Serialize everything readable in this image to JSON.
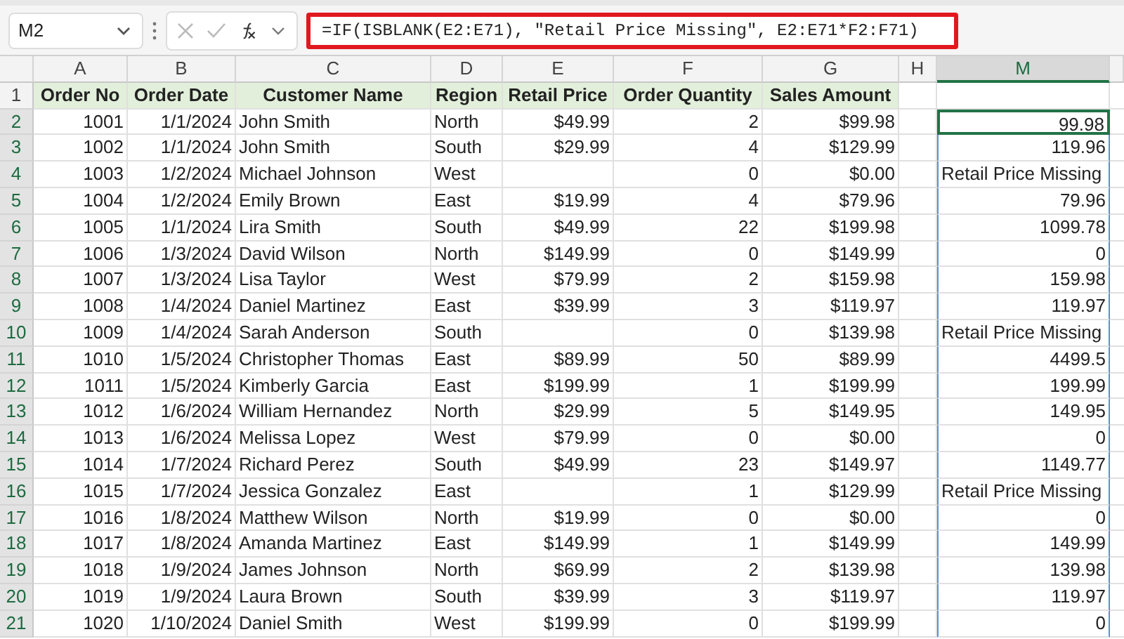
{
  "name_box": {
    "value": "M2"
  },
  "formula_bar": {
    "formula": "=IF(ISBLANK(E2:E71), \"Retail Price Missing\", E2:E71*F2:F71)",
    "highlighted": true
  },
  "column_headers": [
    {
      "label": "A",
      "selected": false
    },
    {
      "label": "B",
      "selected": false
    },
    {
      "label": "C",
      "selected": false
    },
    {
      "label": "D",
      "selected": false
    },
    {
      "label": "E",
      "selected": false
    },
    {
      "label": "F",
      "selected": false
    },
    {
      "label": "G",
      "selected": false
    },
    {
      "label": "H",
      "selected": false
    },
    {
      "label": "M",
      "selected": true
    }
  ],
  "rows": [
    {
      "number": "1",
      "kind": "header",
      "selected": false,
      "cells": [
        "Order No",
        "Order Date",
        "Customer Name",
        "Region",
        "Retail Price",
        "Order Quantity",
        "Sales Amount"
      ]
    },
    {
      "number": "2",
      "kind": "data",
      "selected": true,
      "cells": [
        "1001",
        "1/1/2024",
        "John Smith",
        "North",
        "$49.99",
        "2",
        "$99.98"
      ],
      "m": {
        "text": "99.98",
        "selected": true,
        "active": true
      }
    },
    {
      "number": "3",
      "kind": "data",
      "selected": true,
      "cells": [
        "1002",
        "1/1/2024",
        "John Smith",
        "South",
        "$29.99",
        "4",
        "$129.99"
      ],
      "m": {
        "text": "119.96",
        "selected": true,
        "active": false
      }
    },
    {
      "number": "4",
      "kind": "data",
      "selected": true,
      "cells": [
        "1003",
        "1/2/2024",
        "Michael Johnson",
        "West",
        null,
        "0",
        "$0.00"
      ],
      "m": {
        "text": "Retail Price Missing",
        "selected": true,
        "active": false
      }
    },
    {
      "number": "5",
      "kind": "data",
      "selected": true,
      "cells": [
        "1004",
        "1/2/2024",
        "Emily Brown",
        "East",
        "$19.99",
        "4",
        "$79.96"
      ],
      "m": {
        "text": "79.96",
        "selected": true,
        "active": false
      }
    },
    {
      "number": "6",
      "kind": "data",
      "selected": true,
      "cells": [
        "1005",
        "1/1/2024",
        "Lira Smith",
        "South",
        "$49.99",
        "22",
        "$199.98"
      ],
      "m": {
        "text": "1099.78",
        "selected": true,
        "active": false
      }
    },
    {
      "number": "7",
      "kind": "data",
      "selected": true,
      "cells": [
        "1006",
        "1/3/2024",
        "David Wilson",
        "North",
        "$149.99",
        "0",
        "$149.99"
      ],
      "m": {
        "text": "0",
        "selected": true,
        "active": false
      }
    },
    {
      "number": "8",
      "kind": "data",
      "selected": true,
      "cells": [
        "1007",
        "1/3/2024",
        "Lisa Taylor",
        "West",
        "$79.99",
        "2",
        "$159.98"
      ],
      "m": {
        "text": "159.98",
        "selected": true,
        "active": false
      }
    },
    {
      "number": "9",
      "kind": "data",
      "selected": true,
      "cells": [
        "1008",
        "1/4/2024",
        "Daniel Martinez",
        "East",
        "$39.99",
        "3",
        "$119.97"
      ],
      "m": {
        "text": "119.97",
        "selected": true,
        "active": false
      }
    },
    {
      "number": "10",
      "kind": "data",
      "selected": true,
      "cells": [
        "1009",
        "1/4/2024",
        "Sarah Anderson",
        "South",
        null,
        "0",
        "$139.98"
      ],
      "m": {
        "text": "Retail Price Missing",
        "selected": true,
        "active": false
      }
    },
    {
      "number": "11",
      "kind": "data",
      "selected": true,
      "cells": [
        "1010",
        "1/5/2024",
        "Christopher Thomas",
        "East",
        "$89.99",
        "50",
        "$89.99"
      ],
      "m": {
        "text": "4499.5",
        "selected": true,
        "active": false
      }
    },
    {
      "number": "12",
      "kind": "data",
      "selected": true,
      "cells": [
        "1011",
        "1/5/2024",
        "Kimberly Garcia",
        "East",
        "$199.99",
        "1",
        "$199.99"
      ],
      "m": {
        "text": "199.99",
        "selected": true,
        "active": false
      }
    },
    {
      "number": "13",
      "kind": "data",
      "selected": true,
      "cells": [
        "1012",
        "1/6/2024",
        "William Hernandez",
        "North",
        "$29.99",
        "5",
        "$149.95"
      ],
      "m": {
        "text": "149.95",
        "selected": true,
        "active": false
      }
    },
    {
      "number": "14",
      "kind": "data",
      "selected": true,
      "cells": [
        "1013",
        "1/6/2024",
        "Melissa Lopez",
        "West",
        "$79.99",
        "0",
        "$0.00"
      ],
      "m": {
        "text": "0",
        "selected": true,
        "active": false
      }
    },
    {
      "number": "15",
      "kind": "data",
      "selected": true,
      "cells": [
        "1014",
        "1/7/2024",
        "Richard Perez",
        "South",
        "$49.99",
        "23",
        "$149.97"
      ],
      "m": {
        "text": "1149.77",
        "selected": true,
        "active": false
      }
    },
    {
      "number": "16",
      "kind": "data",
      "selected": true,
      "cells": [
        "1015",
        "1/7/2024",
        "Jessica Gonzalez",
        "East",
        null,
        "1",
        "$129.99"
      ],
      "m": {
        "text": "Retail Price Missing",
        "selected": true,
        "active": false
      }
    },
    {
      "number": "17",
      "kind": "data",
      "selected": true,
      "cells": [
        "1016",
        "1/8/2024",
        "Matthew Wilson",
        "North",
        "$19.99",
        "0",
        "$0.00"
      ],
      "m": {
        "text": "0",
        "selected": true,
        "active": false
      }
    },
    {
      "number": "18",
      "kind": "data",
      "selected": true,
      "cells": [
        "1017",
        "1/8/2024",
        "Amanda Martinez",
        "East",
        "$149.99",
        "1",
        "$149.99"
      ],
      "m": {
        "text": "149.99",
        "selected": true,
        "active": false
      }
    },
    {
      "number": "19",
      "kind": "data",
      "selected": true,
      "cells": [
        "1018",
        "1/9/2024",
        "James Johnson",
        "North",
        "$69.99",
        "2",
        "$139.98"
      ],
      "m": {
        "text": "139.98",
        "selected": true,
        "active": false
      }
    },
    {
      "number": "20",
      "kind": "data",
      "selected": true,
      "cells": [
        "1019",
        "1/9/2024",
        "Laura Brown",
        "South",
        "$39.99",
        "3",
        "$119.97"
      ],
      "m": {
        "text": "119.97",
        "selected": true,
        "active": false
      }
    },
    {
      "number": "21",
      "kind": "data",
      "selected": true,
      "cells": [
        "1020",
        "1/10/2024",
        "Daniel Smith",
        "West",
        "$199.99",
        "0",
        "$199.99"
      ],
      "m": {
        "text": "0",
        "selected": true,
        "active": false
      }
    }
  ]
}
